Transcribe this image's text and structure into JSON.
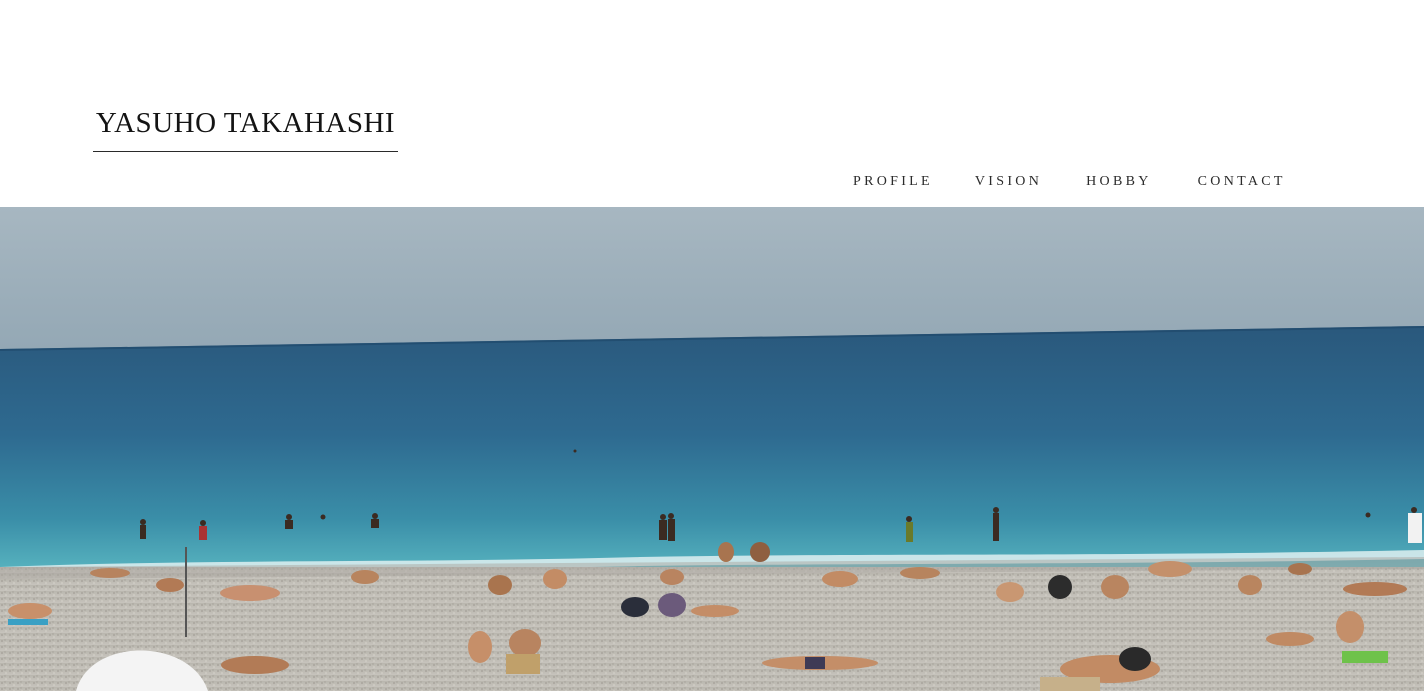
{
  "site": {
    "title": "YASUHO TAKAHASHI"
  },
  "nav": {
    "items": [
      {
        "label": "PROFILE"
      },
      {
        "label": "VISION"
      },
      {
        "label": "HOBBY"
      },
      {
        "label": "CONTACT"
      }
    ]
  },
  "hero": {
    "icon": "beach-photo",
    "colors": {
      "sky_top": "#a6b7c1",
      "sky_bottom": "#93a7b4",
      "sea_far": "#2a5a7f",
      "sea_mid": "#2f6f94",
      "sea_near": "#3f9bb0",
      "foam": "#dfeef0",
      "pebbles": "#bdbab3"
    }
  }
}
